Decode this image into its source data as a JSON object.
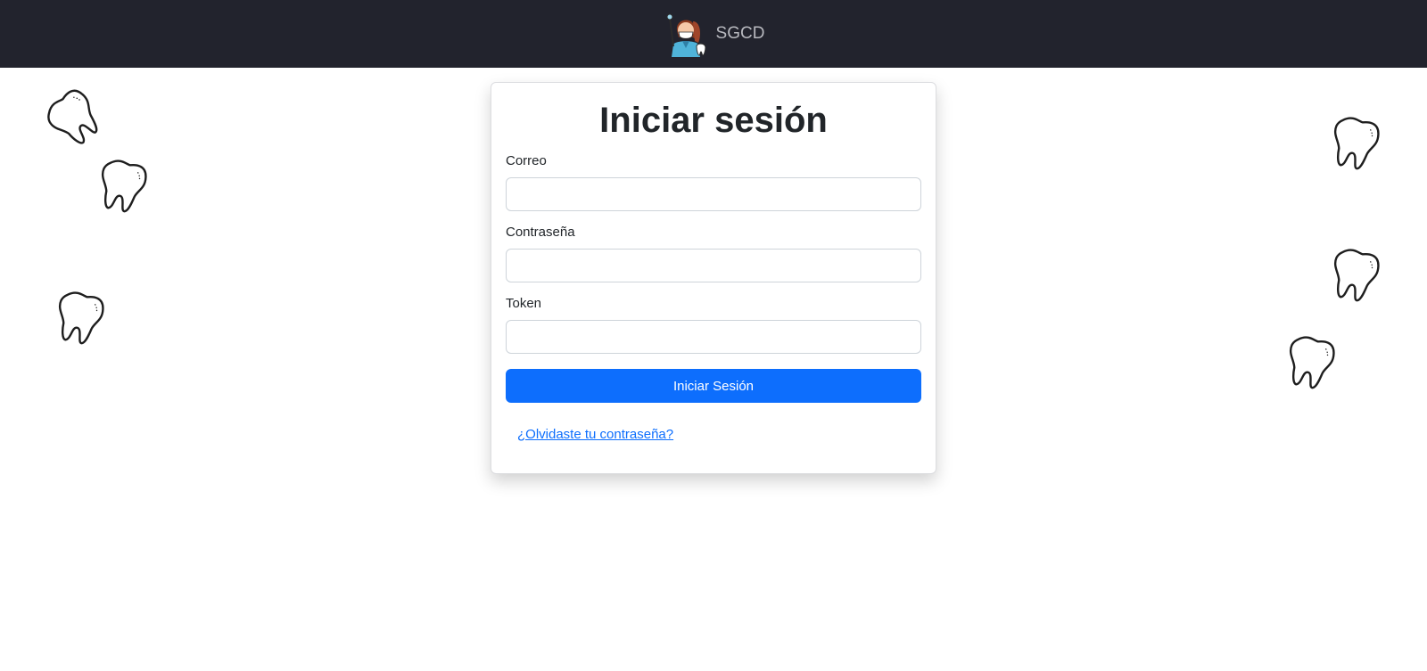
{
  "navbar": {
    "brand_name": "SGCD",
    "logo_icon": "dentist-avatar-icon",
    "background_color": "#22232d"
  },
  "decorations": {
    "icon": "tooth-icon"
  },
  "login": {
    "title": "Iniciar sesión",
    "email_label": "Correo",
    "email_value": "",
    "password_label": "Contraseña",
    "password_value": "",
    "token_label": "Token",
    "token_value": "",
    "submit_label": "Iniciar Sesión",
    "forgot_link": "¿Olvidaste tu contraseña?"
  },
  "colors": {
    "primary": "#0d6efd",
    "navbar": "#22232d",
    "text": "#212529"
  }
}
